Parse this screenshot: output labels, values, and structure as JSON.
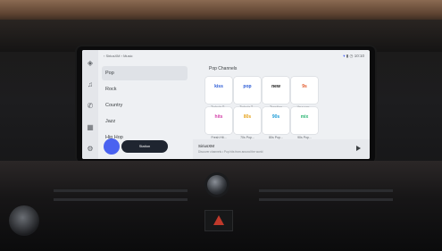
{
  "breadcrumb": {
    "app": "SiriusXM",
    "section": "Music"
  },
  "status": {
    "time": "10:10"
  },
  "nav": {
    "items": [
      {
        "label": "Pop",
        "selected": true
      },
      {
        "label": "Rock"
      },
      {
        "label": "Country"
      },
      {
        "label": "Jazz"
      },
      {
        "label": "Hip Hop"
      }
    ]
  },
  "fab": {
    "pill_label": "Station"
  },
  "main": {
    "section_title": "Pop Channels",
    "tiles": [
      {
        "logo": "kiss",
        "caption": "Today's P...",
        "color": "#2b5bd6"
      },
      {
        "logo": "pop",
        "caption": "Today's T...",
        "color": "#2b5bd6"
      },
      {
        "logo": "new",
        "caption": "Trending",
        "color": "#111111"
      },
      {
        "logo": "9s",
        "caption": "Your pop...",
        "color": "#e25a2b"
      },
      {
        "logo": "hits",
        "caption": "Fresh Hit...",
        "color": "#d33fa8"
      },
      {
        "logo": "80s",
        "caption": "70s Pop...",
        "color": "#e6a21b"
      },
      {
        "logo": "90s",
        "caption": "80s Pop...",
        "color": "#1a9ad6"
      },
      {
        "logo": "mix",
        "caption": "90s Pop...",
        "color": "#2bb673"
      }
    ]
  },
  "now_playing": {
    "title": "SiriusXM",
    "subtitle": "Discover channels • Pop hits from around the world"
  }
}
